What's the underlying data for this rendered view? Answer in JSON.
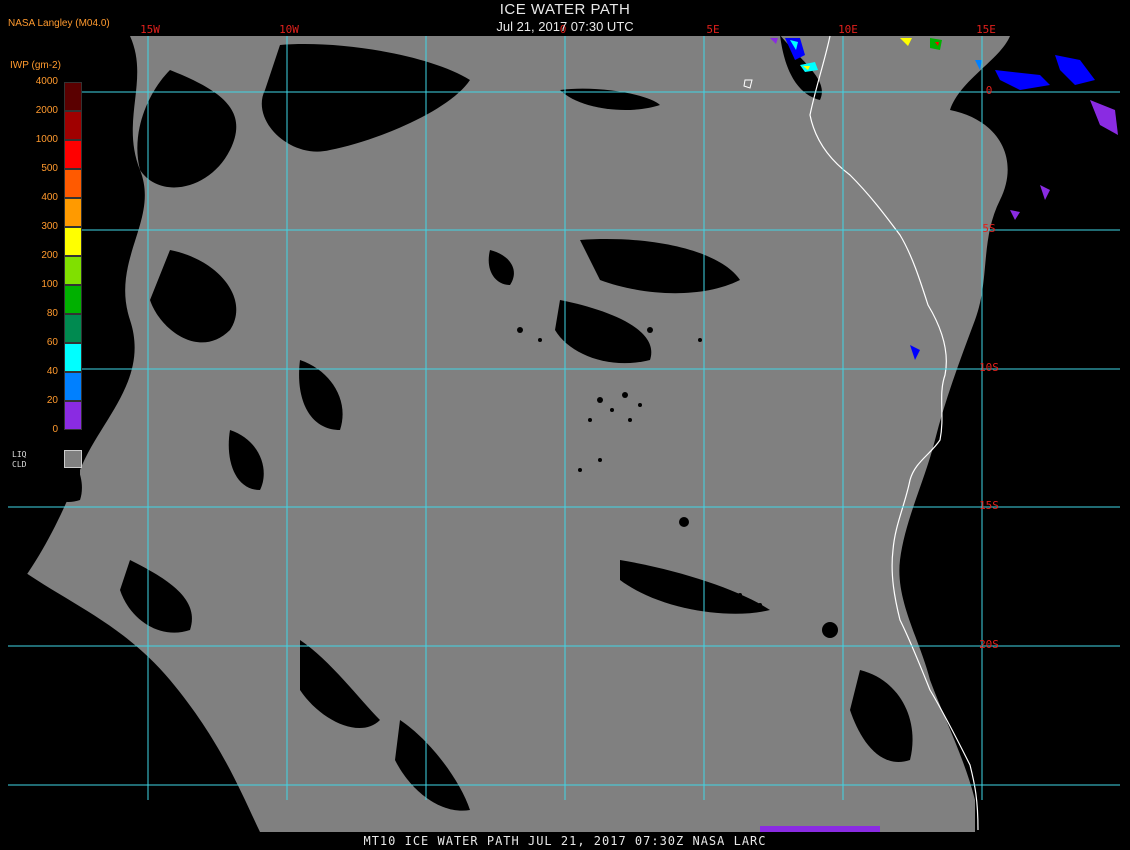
{
  "title": "ICE WATER PATH",
  "subtitle": "Jul 21, 2017 07:30 UTC",
  "source": "NASA Langley (M04.0)",
  "footer": "MT10  ICE WATER PATH   JUL 21, 2017 07:30Z   NASA LARC",
  "legend": {
    "title": "IWP (gm-2)",
    "items": [
      {
        "label": "4000",
        "color": "#5a0000"
      },
      {
        "label": "2000",
        "color": "#a00000"
      },
      {
        "label": "1000",
        "color": "#ff0000"
      },
      {
        "label": "500",
        "color": "#ff5a00"
      },
      {
        "label": "400",
        "color": "#ff9a00"
      },
      {
        "label": "300",
        "color": "#ffff00"
      },
      {
        "label": "200",
        "color": "#80e000"
      },
      {
        "label": "100",
        "color": "#00b000"
      },
      {
        "label": "80",
        "color": "#008a50"
      },
      {
        "label": "60",
        "color": "#00ffff"
      },
      {
        "label": "40",
        "color": "#0080ff"
      },
      {
        "label": "20",
        "color": "#0000ff"
      },
      {
        "label": "0",
        "color": "#8a2be2"
      }
    ],
    "liq_label_1": "LIQ",
    "liq_label_2": "CLD",
    "liq_color": "#808080"
  },
  "lon_labels": [
    "15W",
    "10W",
    "0",
    "5E",
    "10E",
    "15E"
  ],
  "lat_labels": [
    "0",
    "5S",
    "10S",
    "15S",
    "20S"
  ],
  "colors": {
    "grid": "#3fd6e6",
    "cloud": "#808080",
    "coast": "#ffffff",
    "label": "#e0201c"
  }
}
